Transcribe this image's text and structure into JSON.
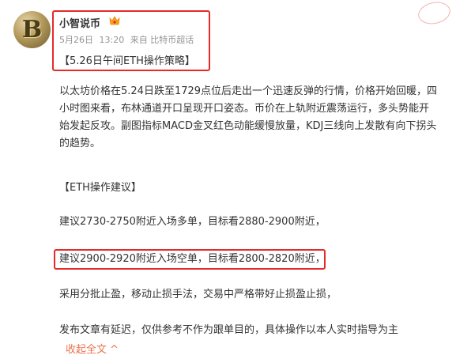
{
  "post": {
    "author": "小智说币",
    "date": "5月26日",
    "time": "13:20",
    "source": "来自 比特币超话",
    "title": "【5.26日午间ETH操作策略】",
    "analysis": "以太坊价格在5.24日跌至1729点位后走出一个迅速反弹的行情，价格开始回暖，四小时图来看，布林通道开口呈现开口姿态。币价在上轨附近震荡运行，多头势能开始发起反攻。副图指标MACD金叉红色动能缓慢放量，KDJ三线向上发散有向下拐头的趋势。",
    "section_header": "【ETH操作建议】",
    "buy_advice": "建议2730-2750附近入场多单，目标看2880-2900附近，",
    "sell_advice": "建议2900-2920附近入场空单，目标看2800-2820附近，",
    "tips": "采用分批止盈，移动止损手法，交易中严格带好止损盈止损，",
    "disclaimer": "发布文章有延迟，仅供参考不作为跟单目的，具体操作以本人实时指导为主",
    "collapse_label": "收起全文",
    "collapse_arrow": "^"
  },
  "icons": {
    "avatar_letter": "B"
  },
  "colors": {
    "highlight": "#e52a2a",
    "link": "#eb7350",
    "meta": "#939393"
  }
}
